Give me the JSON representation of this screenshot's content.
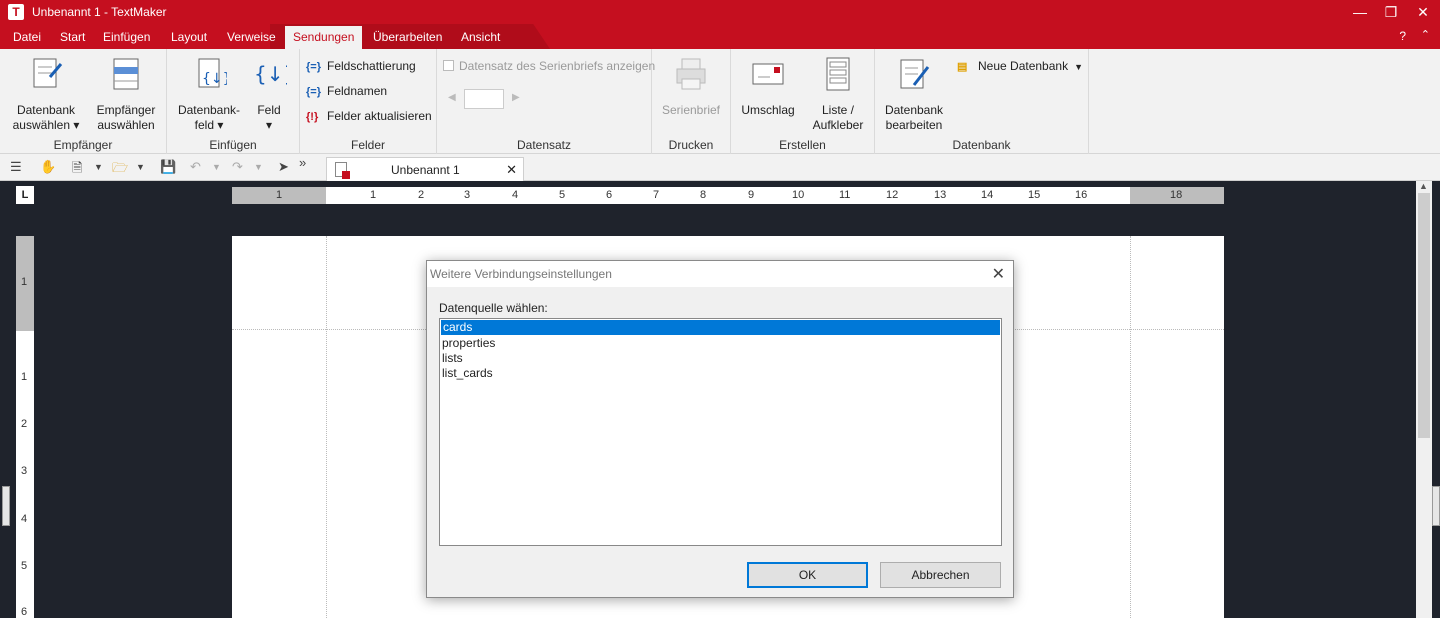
{
  "window": {
    "title": "Unbenannt 1 - TextMaker",
    "app_icon_letter": "T"
  },
  "menu": {
    "items": [
      "Datei",
      "Start",
      "Einfügen",
      "Layout",
      "Verweise",
      "Sendungen",
      "Überarbeiten",
      "Ansicht"
    ],
    "active": "Sendungen",
    "help": "?",
    "collapse": "⌃"
  },
  "ribbon": {
    "groups": {
      "empfaenger": {
        "label": "Empfänger",
        "datenbank_auswaehlen": [
          "Datenbank",
          "auswählen ▾"
        ],
        "empfaenger_auswaehlen": [
          "Empfänger",
          "auswählen"
        ]
      },
      "einfuegen": {
        "label": "Einfügen",
        "datenbankfeld": [
          "Datenbank-",
          "feld ▾"
        ],
        "feld": [
          "Feld",
          "▾"
        ]
      },
      "felder": {
        "label": "Felder",
        "feldschattierung": "Feldschattierung",
        "feldnamen": "Feldnamen",
        "felder_aktualisieren": "Felder aktualisieren"
      },
      "datensatz": {
        "label": "Datensatz",
        "checkbox_label": "Datensatz des Serienbriefs anzeigen"
      },
      "drucken": {
        "label": "Drucken",
        "serienbrief": "Serienbrief"
      },
      "erstellen": {
        "label": "Erstellen",
        "umschlag": "Umschlag",
        "liste_aufkleber": [
          "Liste /",
          "Aufkleber"
        ]
      },
      "datenbank": {
        "label": "Datenbank",
        "datenbank_bearbeiten": [
          "Datenbank",
          "bearbeiten"
        ],
        "neue_datenbank": "Neue Datenbank"
      }
    }
  },
  "document_tab": {
    "label": "Unbenannt 1",
    "close": "✕"
  },
  "ruler": {
    "horizontal": [
      "1",
      "1",
      "2",
      "3",
      "4",
      "5",
      "6",
      "7",
      "8",
      "9",
      "10",
      "11",
      "12",
      "13",
      "14",
      "15",
      "16",
      "18"
    ],
    "vertical": [
      "1",
      "1",
      "2",
      "3",
      "4",
      "5",
      "6"
    ]
  },
  "dialog": {
    "title": "Weitere Verbindungseinstellungen",
    "label": "Datenquelle wählen:",
    "sources": [
      "cards",
      "properties",
      "lists",
      "list_cards"
    ],
    "selected": "cards",
    "ok": "OK",
    "cancel": "Abbrechen"
  }
}
